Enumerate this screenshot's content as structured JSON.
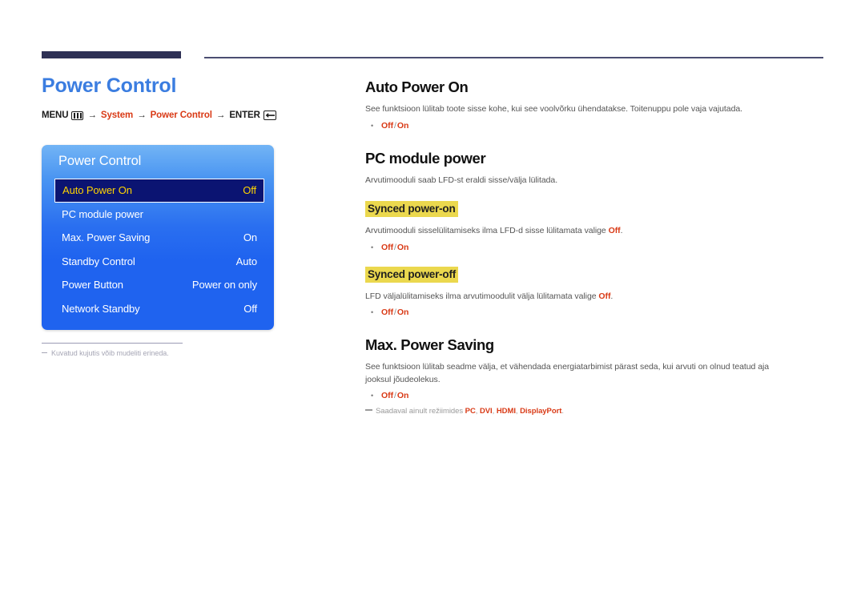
{
  "header": {
    "thick_rule_color": "#2e3055",
    "thin_rule_color": "#4b4e72"
  },
  "left": {
    "page_title": "Power Control",
    "breadcrumb": {
      "menu_label": "MENU",
      "menu_icon": "menu-bars-icon",
      "arrow": "→",
      "path_1": "System",
      "path_2": "Power Control",
      "enter_label": "ENTER",
      "enter_icon": "enter-return-icon"
    },
    "osd": {
      "title": "Power Control",
      "rows": [
        {
          "label": "Auto Power On",
          "value": "Off",
          "selected": true
        },
        {
          "label": "PC module power",
          "value": "",
          "selected": false
        },
        {
          "label": "Max. Power Saving",
          "value": "On",
          "selected": false
        },
        {
          "label": "Standby Control",
          "value": "Auto",
          "selected": false
        },
        {
          "label": "Power Button",
          "value": "Power on only",
          "selected": false
        },
        {
          "label": "Network Standby",
          "value": "Off",
          "selected": false
        }
      ],
      "accent_selected_bg": "#0b1472",
      "accent_selected_text": "#ffd400",
      "panel_blue": "#1f63ef"
    },
    "note": "Kuvatud kujutis võib mudeliti erineda."
  },
  "right": {
    "auto_power_on": {
      "heading": "Auto Power On",
      "body": "See funktsioon lülitab toote sisse kohe, kui see voolvõrku ühendatakse. Toitenuppu pole vaja vajutada.",
      "option_off": "Off",
      "option_sep": "/",
      "option_on": "On"
    },
    "pc_module_power": {
      "heading": "PC module power",
      "body": "Arvutimooduli saab LFD-st eraldi sisse/välja lülitada.",
      "synced_on": {
        "heading": "Synced power-on",
        "body_pre": "Arvutimooduli sisselülitamiseks ilma LFD-d sisse lülitamata valige ",
        "body_bold": "Off",
        "body_post": ".",
        "option_off": "Off",
        "option_sep": "/",
        "option_on": "On"
      },
      "synced_off": {
        "heading": "Synced power-off",
        "body_pre": "LFD väljalülitamiseks ilma arvutimoodulit välja lülitamata valige ",
        "body_bold": "Off",
        "body_post": ".",
        "option_off": "Off",
        "option_sep": "/",
        "option_on": "On"
      }
    },
    "max_power_saving": {
      "heading": "Max. Power Saving",
      "body": "See funktsioon lülitab seadme välja, et vähendada energiatarbimist pärast seda, kui arvuti on olnud teatud aja jooksul jõudeolekus.",
      "option_off": "Off",
      "option_sep": "/",
      "option_on": "On",
      "footnote_pre": "Saadaval ainult režiimides ",
      "footnote_modes": [
        "PC",
        "DVI",
        "HDMI",
        "DisplayPort"
      ],
      "footnote_post": "."
    },
    "highlight_color": "#ebd84e",
    "accent_red": "#d93a16"
  }
}
